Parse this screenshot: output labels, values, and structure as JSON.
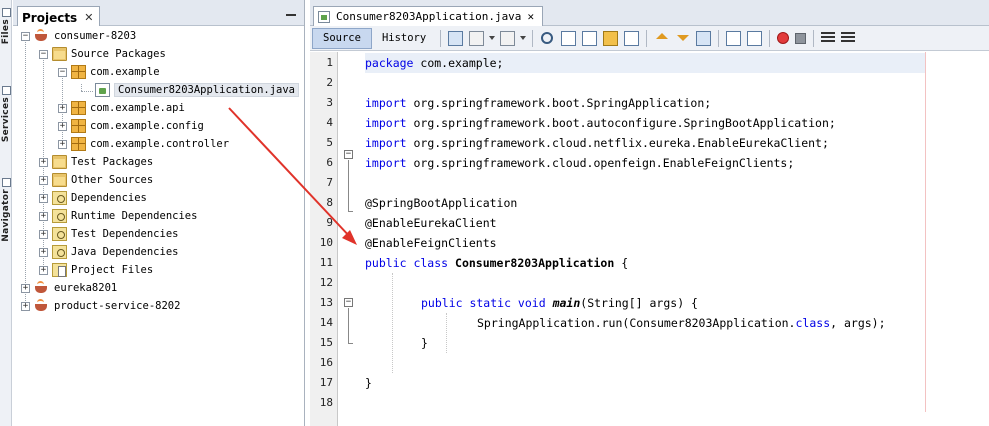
{
  "sidebar_strip": {
    "tabs": [
      {
        "label": "Files",
        "icon": "files-icon"
      },
      {
        "label": "Services",
        "icon": "services-icon"
      },
      {
        "label": "Navigator",
        "icon": "navigator-icon"
      }
    ]
  },
  "projects": {
    "tab_label": "Projects",
    "close_glyph": "✕",
    "tree": [
      {
        "label": "consumer-8203",
        "icon": "maven-project-icon",
        "exp": "−"
      },
      {
        "label": "Source Packages",
        "icon": "folder-icon",
        "exp": "−"
      },
      {
        "label": "com.example",
        "icon": "package-icon",
        "exp": "−"
      },
      {
        "label": "Consumer8203Application.java",
        "icon": "java-file-icon",
        "exp": ""
      },
      {
        "label": "com.example.api",
        "icon": "package-icon",
        "exp": "+"
      },
      {
        "label": "com.example.config",
        "icon": "package-icon",
        "exp": "+"
      },
      {
        "label": "com.example.controller",
        "icon": "package-icon",
        "exp": "+"
      },
      {
        "label": "Test Packages",
        "icon": "folder-icon",
        "exp": "+"
      },
      {
        "label": "Other Sources",
        "icon": "folder-icon",
        "exp": "+"
      },
      {
        "label": "Dependencies",
        "icon": "dependencies-icon",
        "exp": "+"
      },
      {
        "label": "Runtime Dependencies",
        "icon": "dependencies-icon",
        "exp": "+"
      },
      {
        "label": "Test Dependencies",
        "icon": "dependencies-icon",
        "exp": "+"
      },
      {
        "label": "Java Dependencies",
        "icon": "dependencies-icon",
        "exp": "+"
      },
      {
        "label": "Project Files",
        "icon": "project-files-icon",
        "exp": "+"
      },
      {
        "label": "eureka8201",
        "icon": "maven-project-icon",
        "exp": "+"
      },
      {
        "label": "product-service-8202",
        "icon": "maven-project-icon",
        "exp": "+"
      }
    ]
  },
  "editor": {
    "tab_label": "Consumer8203Application.java",
    "close_glyph": "✕",
    "source_label": "Source",
    "history_label": "History",
    "line_numbers": [
      "1",
      "2",
      "3",
      "4",
      "5",
      "6",
      "7",
      "8",
      "9",
      "10",
      "11",
      "12",
      "13",
      "14",
      "15",
      "16",
      "17",
      "18"
    ],
    "code": {
      "l1_kw": "package",
      "l1_rest": " com.example;",
      "l3_kw": "import",
      "l3_rest": " org.springframework.boot.SpringApplication;",
      "l4_kw": "import",
      "l4_rest": " org.springframework.boot.autoconfigure.SpringBootApplication;",
      "l5_kw": "import",
      "l5_rest": " org.springframework.cloud.netflix.eureka.EnableEurekaClient;",
      "l6_kw": "import",
      "l6_rest": " org.springframework.cloud.openfeign.EnableFeignClients;",
      "l8": "@SpringBootApplication",
      "l9": "@EnableEurekaClient",
      "l10": "@EnableFeignClients",
      "l11_kw": "public class ",
      "l11_name": "Consumer8203Application",
      "l11_rest": " {",
      "l13_kw": "public static void ",
      "l13_name": "main",
      "l13_rest": "(String[] args) {",
      "l14_a": "SpringApplication.run(Consumer8203Application.",
      "l14_kw": "class",
      "l14_b": ", args);",
      "l15": "}",
      "l17": "}"
    }
  },
  "colors": {
    "keyword": "#0000e6",
    "arrow": "#e0332a"
  }
}
